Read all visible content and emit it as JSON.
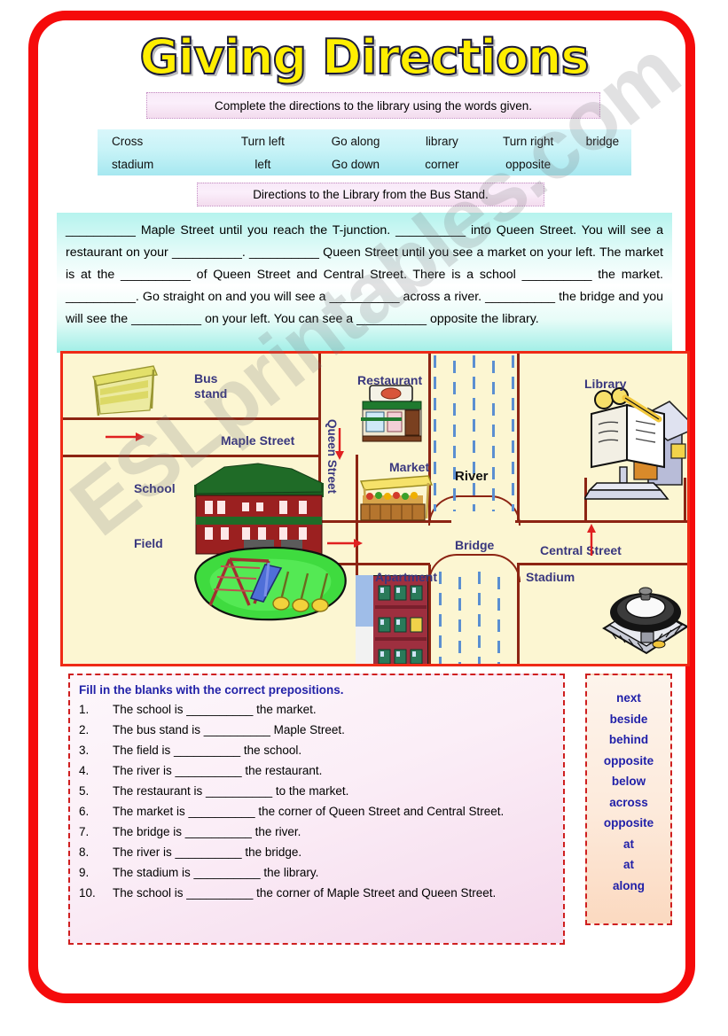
{
  "title": "Giving Directions",
  "instruction": "Complete the directions to the library using the words given.",
  "word_bank": {
    "row1": [
      "Cross",
      "Turn left",
      "Go along",
      "library",
      "Turn right",
      "bridge"
    ],
    "row2": [
      "stadium",
      "left",
      "Go down",
      "corner",
      "opposite",
      ""
    ]
  },
  "directions_title": "Directions to the Library from the Bus Stand.",
  "paragraph": "__________ Maple Street until you reach the T-junction. __________ into Queen Street. You will see a restaurant on your __________. __________ Queen Street until you see a market on your left. The market is at the __________ of Queen Street and Central Street. There is a school __________ the market. __________. Go straight on and you will see a __________ across a river. __________ the bridge and you will see the __________ on your left. You can see a __________ opposite the library.",
  "map": {
    "labels": {
      "bus_stand": "Bus\nstand",
      "maple_street": "Maple Street",
      "school": "School",
      "field": "Field",
      "queen_street": "Queen Street",
      "restaurant": "Restaurant",
      "market": "Market",
      "river": "River",
      "library": "Library",
      "bridge": "Bridge",
      "central_street": "Central Street",
      "apartment": "Apartment",
      "stadium": "Stadium"
    },
    "colors": {
      "background": "#fcf6d2",
      "road": "#8c2413",
      "river": "#5b8fd1",
      "border": "#ef2a16",
      "label": "#39377e",
      "arrow": "#e02020"
    }
  },
  "exercise": {
    "heading": "Fill in the blanks with the correct prepositions.",
    "items": [
      {
        "num": "1.",
        "text": "The school is __________ the market."
      },
      {
        "num": "2.",
        "text": "The bus stand is __________ Maple Street."
      },
      {
        "num": "3.",
        "text": "The field is __________ the school."
      },
      {
        "num": "4.",
        "text": "The river is __________ the restaurant."
      },
      {
        "num": "5.",
        "text": "The restaurant is __________ to the market."
      },
      {
        "num": "6.",
        "text": "The market is __________ the corner of Queen Street and Central Street."
      },
      {
        "num": "7.",
        "text": "The bridge is __________ the river."
      },
      {
        "num": "8.",
        "text": "The river is __________ the bridge."
      },
      {
        "num": "9.",
        "text": "The stadium is __________ the library."
      },
      {
        "num": "10.",
        "text": "The school is __________ the corner of Maple Street and Queen Street."
      }
    ]
  },
  "preposition_list": [
    "next",
    "beside",
    "behind",
    "opposite",
    "below",
    "across",
    "opposite",
    "at",
    "at",
    "along"
  ],
  "watermark": "ESLprintables.com",
  "colors": {
    "frame_red": "#f50b0b",
    "title_yellow": "#ffee00",
    "title_outline": "#1b1b3a",
    "pink_border": "#c48fc4",
    "cyan_band": "#a6e8f0",
    "exercise_border": "#cf1f1f",
    "heading_blue": "#2222a8"
  }
}
